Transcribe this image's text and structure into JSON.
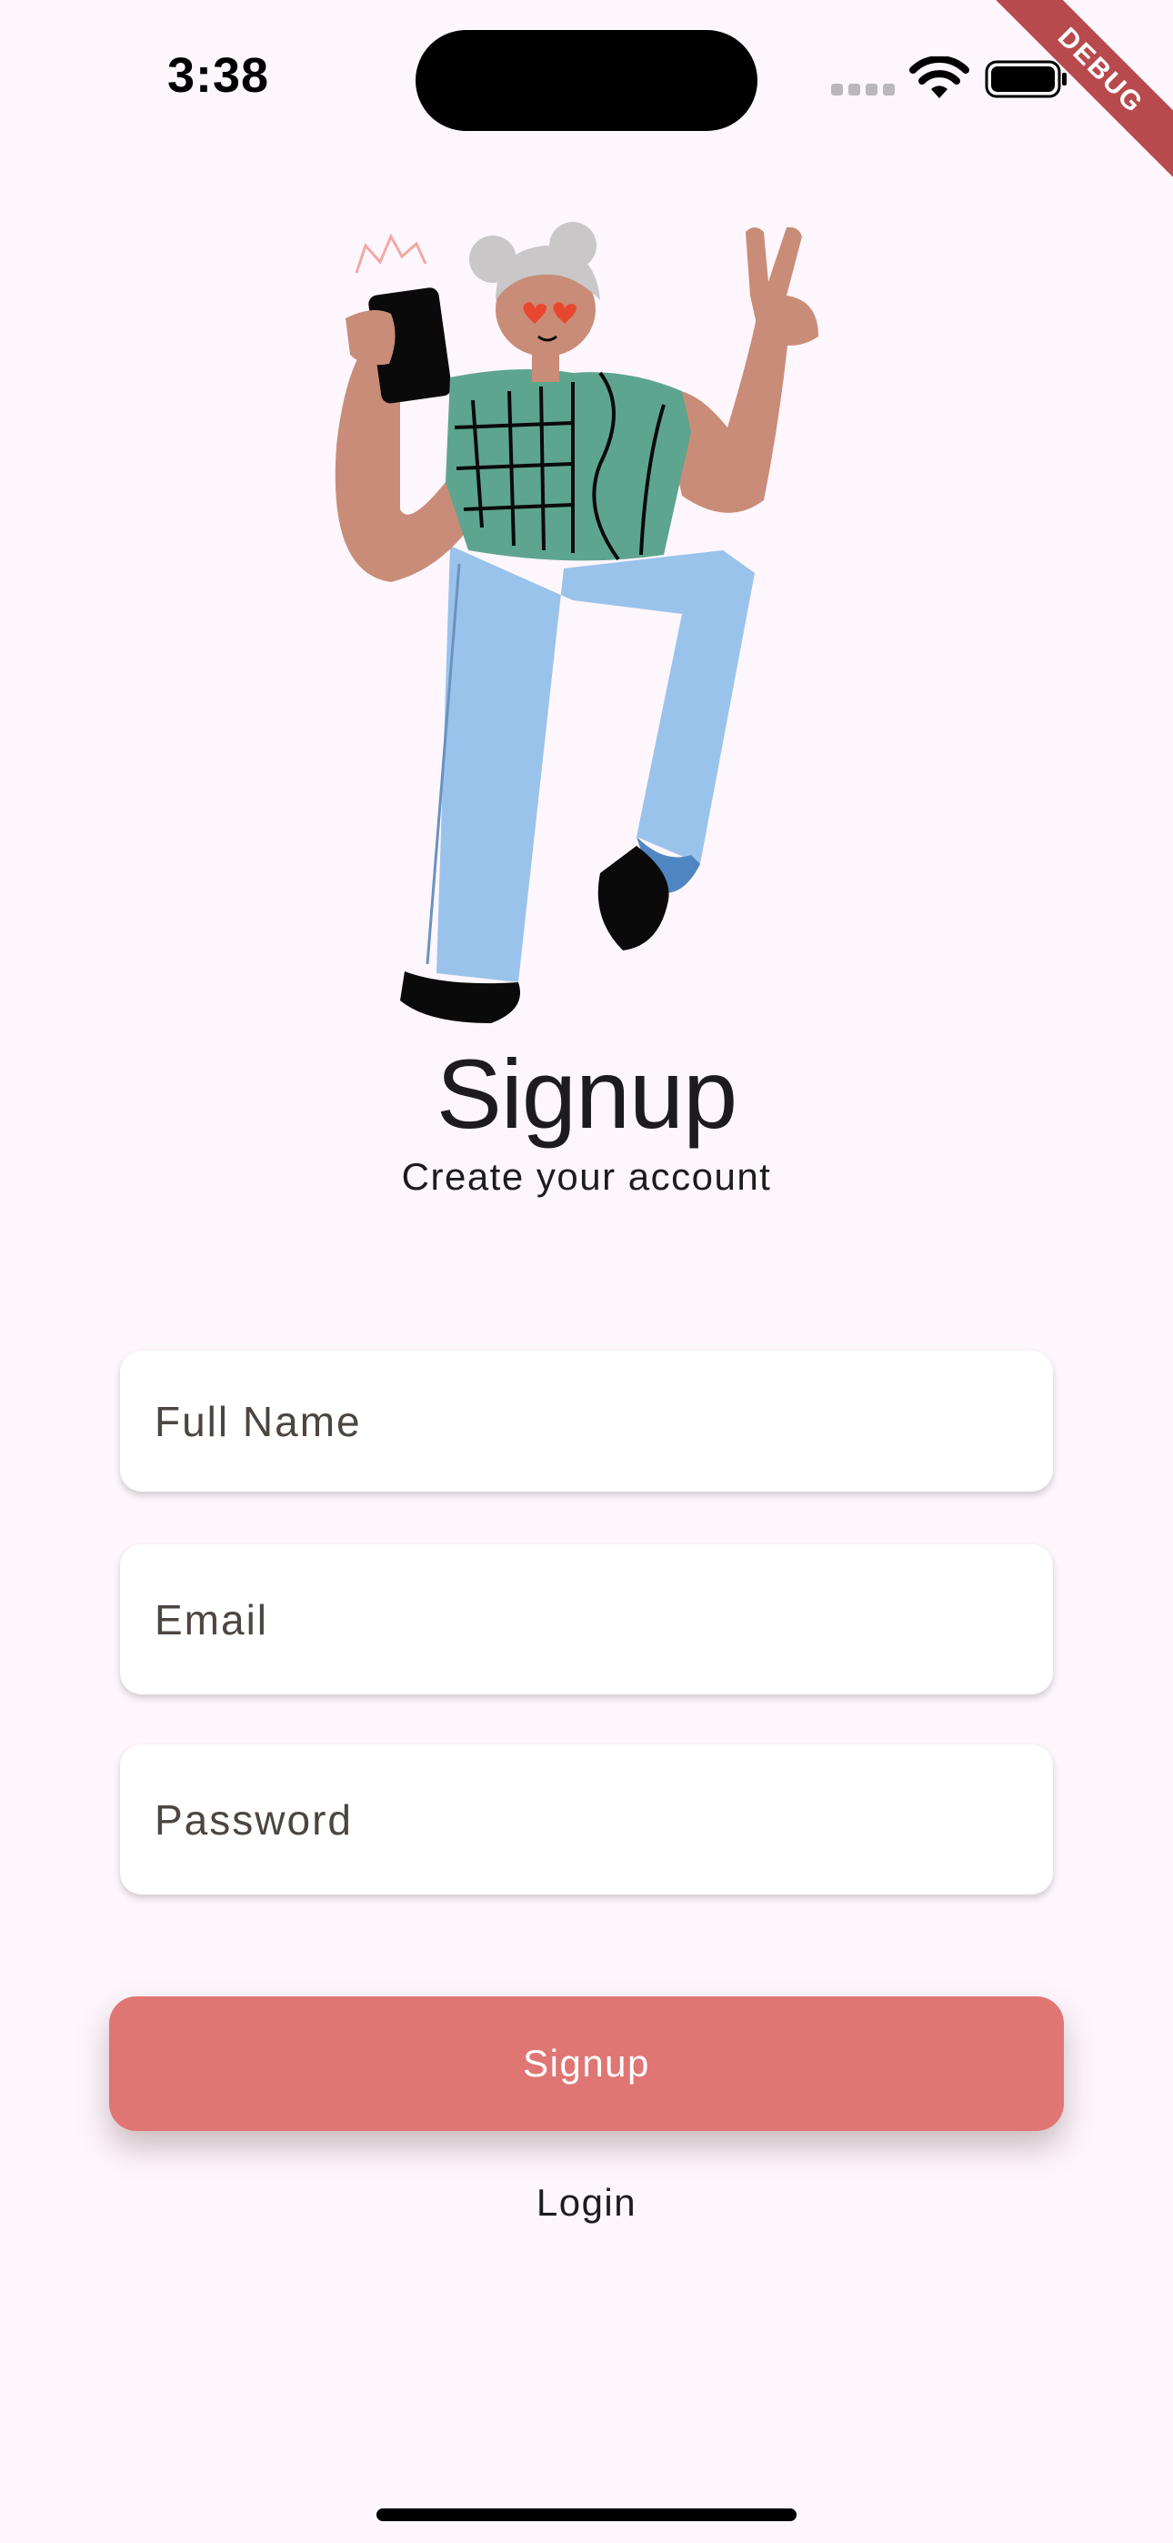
{
  "status_bar": {
    "time": "3:38",
    "icons": [
      "cellular-signal-icon",
      "wifi-icon",
      "battery-icon"
    ]
  },
  "debug_banner": "DEBUG",
  "illustration": {
    "icon": "person-with-phone-illustration",
    "colors": {
      "shirt": "#5ea58f",
      "pants": "#9ac3ec",
      "skin": "#c98c78",
      "hair": "#c9c7c8"
    }
  },
  "header": {
    "title": "Signup",
    "subtitle": "Create your account"
  },
  "form": {
    "full_name": {
      "value": "",
      "placeholder": "Full Name"
    },
    "email": {
      "value": "",
      "placeholder": "Email"
    },
    "password": {
      "value": "",
      "placeholder": "Password"
    }
  },
  "actions": {
    "signup_label": "Signup",
    "login_label": "Login"
  },
  "colors": {
    "background": "#fdf6fc",
    "primary_button": "#df7673",
    "field_background": "#ffffff"
  }
}
